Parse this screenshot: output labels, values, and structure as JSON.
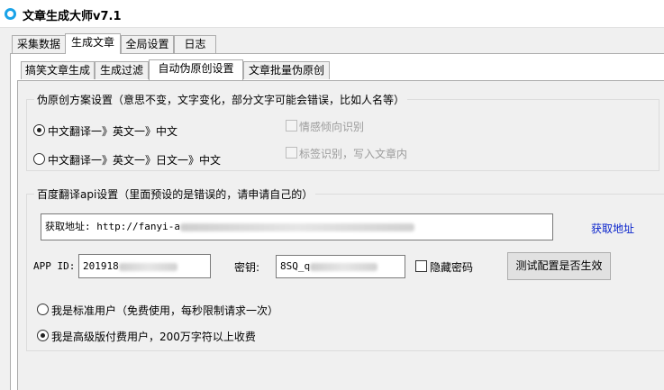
{
  "window": {
    "title": "文章生成大师v7.1"
  },
  "main_tabs": [
    {
      "label": "采集数据"
    },
    {
      "label": "生成文章"
    },
    {
      "label": "全局设置"
    },
    {
      "label": "日志"
    }
  ],
  "sub_tabs": [
    {
      "label": "搞笑文章生成"
    },
    {
      "label": "生成过滤"
    },
    {
      "label": "自动伪原创设置"
    },
    {
      "label": "文章批量伪原创"
    }
  ],
  "scheme_group": {
    "title": "伪原创方案设置（意思不变，文字变化，部分文字可能会错误，比如人名等）",
    "option1": "中文翻译一》英文一》中文",
    "option2": "中文翻译一》英文一》日文一》中文",
    "emotion_check": "情感倾向识别",
    "tag_check": "标签识别，写入文章内"
  },
  "api_group": {
    "title": "百度翻译api设置（里面预设的是错误的，请申请自己的）",
    "url_value": "获取地址: http://fanyi-a",
    "get_link": "获取地址",
    "appid_label": "APP ID:",
    "appid_value": "201918",
    "secret_label": "密钥:",
    "secret_value": "8SQ_q",
    "hide_secret": "隐藏密码",
    "test_button": "测试配置是否生效",
    "user_standard": "我是标准用户（免费使用，每秒限制请求一次）",
    "user_premium": "我是高级版付费用户，200万字符以上收费"
  }
}
